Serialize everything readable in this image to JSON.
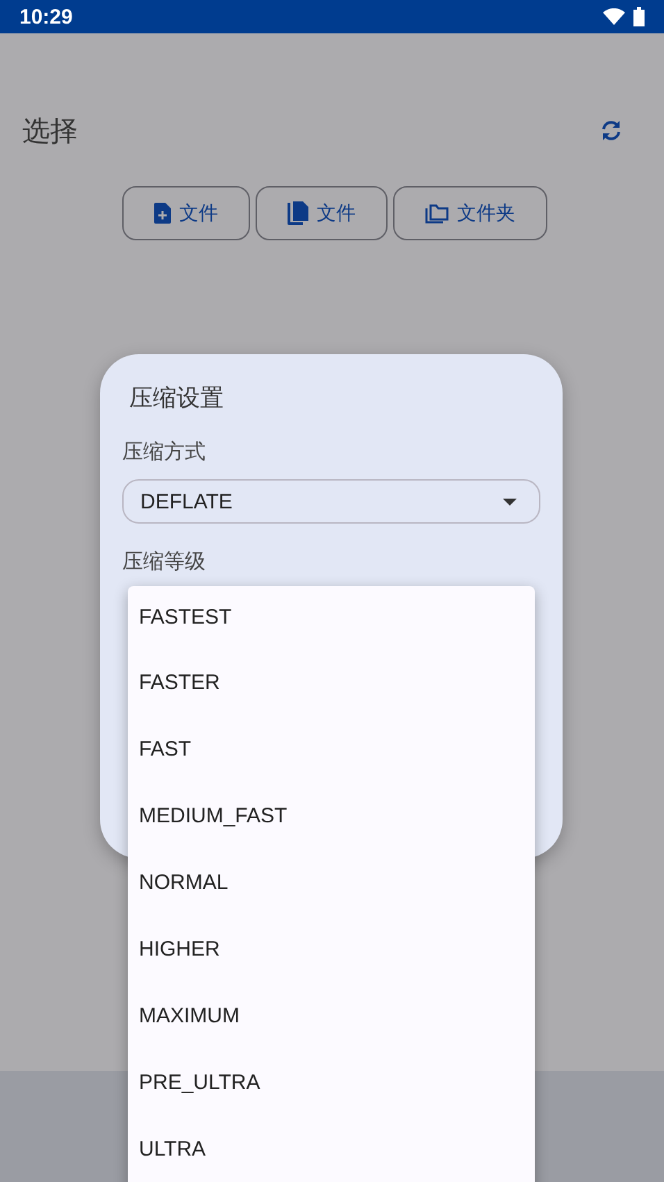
{
  "status_bar": {
    "time": "10:29"
  },
  "header": {
    "title": "选择"
  },
  "buttons": [
    {
      "kind": "file",
      "label": "文件"
    },
    {
      "kind": "files",
      "label": "文件"
    },
    {
      "kind": "folder",
      "label": "文件夹"
    }
  ],
  "dialog": {
    "title": "压缩设置",
    "method_label": "压缩方式",
    "method_value": "DEFLATE",
    "level_label": "压缩等级"
  },
  "menu": {
    "items": [
      {
        "label": "FASTEST"
      },
      {
        "label": "FASTER"
      },
      {
        "label": "FAST"
      },
      {
        "label": "MEDIUM_FAST"
      },
      {
        "label": "NORMAL"
      },
      {
        "label": "HIGHER"
      },
      {
        "label": "MAXIMUM"
      },
      {
        "label": "PRE_ULTRA"
      },
      {
        "label": "ULTRA"
      }
    ]
  }
}
